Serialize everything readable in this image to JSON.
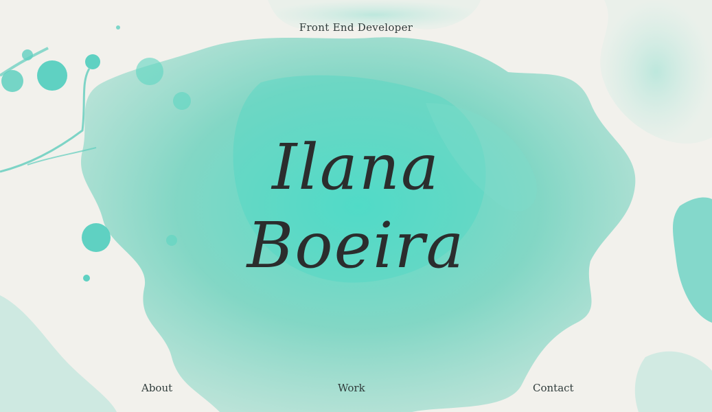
{
  "header": {
    "subtitle": "Front End Developer"
  },
  "hero": {
    "first_name": "Ilana",
    "last_name": "Boeira"
  },
  "nav": {
    "about": "About",
    "work": "Work",
    "contact": "Contact"
  },
  "colors": {
    "background": "#f2f1ec",
    "watercolor": "#5fd3bf",
    "text": "#2b2d2d"
  }
}
